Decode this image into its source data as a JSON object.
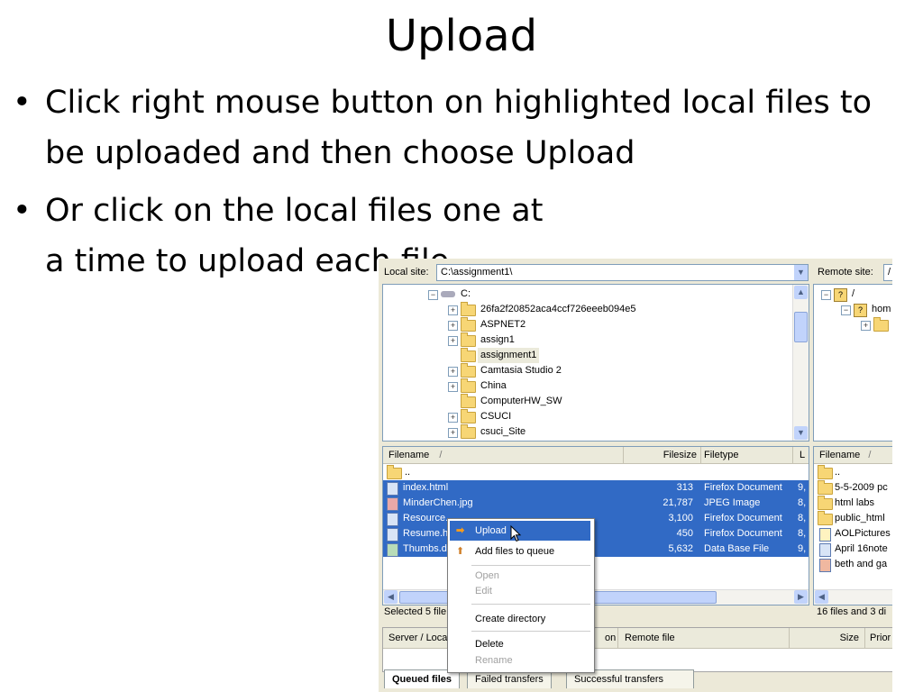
{
  "slide": {
    "title": "Upload",
    "bullets": [
      "Click right mouse button on highlighted local files to be uploaded and then choose Upload",
      "Or click on the local files one at a time to upload each file."
    ]
  },
  "local_site": {
    "label": "Local site:",
    "path": "C:\\assignment1\\"
  },
  "remote_site": {
    "label": "Remote site:",
    "path": "/"
  },
  "local_tree": [
    {
      "name": "C:",
      "expander": "−",
      "icon": "drive-icon"
    },
    {
      "name": "26fa2f20852aca4ccf726eeeb094e5",
      "expander": "+"
    },
    {
      "name": "ASPNET2",
      "expander": "+"
    },
    {
      "name": "assign1",
      "expander": "+"
    },
    {
      "name": "assignment1",
      "expander": ""
    },
    {
      "name": "Camtasia Studio 2",
      "expander": "+"
    },
    {
      "name": "China",
      "expander": "+"
    },
    {
      "name": "ComputerHW_SW",
      "expander": ""
    },
    {
      "name": "CSUCI",
      "expander": "+"
    },
    {
      "name": "csuci_Site",
      "expander": "+"
    }
  ],
  "remote_tree": [
    {
      "name": "/",
      "expander": "−"
    },
    {
      "name": "hom",
      "expander": "−"
    },
    {
      "name": "",
      "expander": "+"
    }
  ],
  "local_files": {
    "columns": [
      "Filename",
      "/",
      "Filesize",
      "Filetype",
      "L"
    ],
    "rows": [
      {
        "name": "..",
        "size": "",
        "type": "",
        "l": ""
      },
      {
        "name": "index.html",
        "size": "313",
        "type": "Firefox Document",
        "l": "9,"
      },
      {
        "name": "MinderChen.jpg",
        "size": "21,787",
        "type": "JPEG Image",
        "l": "8,"
      },
      {
        "name": "Resource.",
        "size": "3,100",
        "type": "Firefox Document",
        "l": "8,"
      },
      {
        "name": "Resume.h",
        "size": "450",
        "type": "Firefox Document",
        "l": "8,"
      },
      {
        "name": "Thumbs.d",
        "size": "5,632",
        "type": "Data Base File",
        "l": "9,"
      }
    ],
    "status": "Selected 5 file"
  },
  "remote_files": {
    "columns": [
      "Filename",
      "/"
    ],
    "rows": [
      "..",
      "5-5-2009 pc",
      "html labs",
      "public_html",
      "AOLPictures",
      "April 16note",
      "beth and ga"
    ],
    "status": "16 files and 3 di"
  },
  "context_menu": {
    "items": [
      {
        "label": "Upload",
        "highlighted": true,
        "disabled": false,
        "icon": "upload-arrow-icon"
      },
      {
        "label": "Add files to queue",
        "highlighted": false,
        "disabled": false,
        "icon": "add-queue-icon"
      },
      {
        "label": "Open",
        "highlighted": false,
        "disabled": true
      },
      {
        "label": "Edit",
        "highlighted": false,
        "disabled": true
      },
      {
        "label": "Create directory",
        "highlighted": false,
        "disabled": false
      },
      {
        "label": "Delete",
        "highlighted": false,
        "disabled": false
      },
      {
        "label": "Rename",
        "highlighted": false,
        "disabled": true
      }
    ]
  },
  "queue": {
    "columns": [
      "Server / Loca",
      "on",
      "Remote file",
      "Size",
      "Prior"
    ],
    "tabs": [
      "Queued files",
      "Failed transfers",
      "Successful transfers"
    ]
  },
  "colors": {
    "selection": "#316ac5",
    "folder": "#f7d675",
    "window": "#ece9d8"
  }
}
